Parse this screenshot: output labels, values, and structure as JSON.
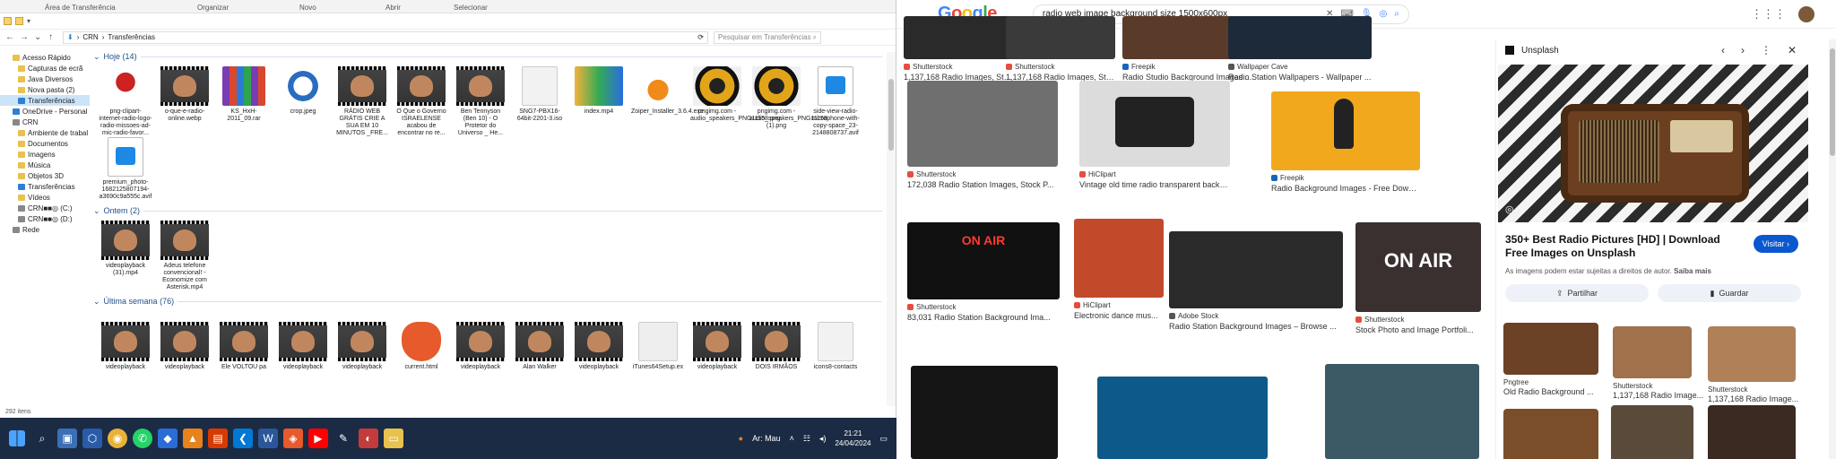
{
  "explorer": {
    "ribbon": {
      "clipboard": "Área de Transferência",
      "organize": "Organizar",
      "new": "Novo",
      "open": "Abrir",
      "select": "Selecionar"
    },
    "breadcrumb": [
      "CRN",
      "Transferências"
    ],
    "search_placeholder": "Pesquisar em Transferências",
    "nav": [
      {
        "label": "Acesso Rápido",
        "type": "star",
        "indent": false
      },
      {
        "label": "Capturas de ecrã",
        "type": "folder",
        "indent": true
      },
      {
        "label": "Java Diversos",
        "type": "folder",
        "indent": true
      },
      {
        "label": "Nova pasta (2)",
        "type": "folder",
        "indent": true
      },
      {
        "label": "Transferências",
        "type": "download",
        "indent": true,
        "selected": true
      },
      {
        "label": "OneDrive - Personal",
        "type": "cloud",
        "indent": false
      },
      {
        "label": "CRN",
        "type": "user",
        "indent": false
      },
      {
        "label": "Ambiente de trabal",
        "type": "folder",
        "indent": true
      },
      {
        "label": "Documentos",
        "type": "folder",
        "indent": true
      },
      {
        "label": "Imagens",
        "type": "folder",
        "indent": true
      },
      {
        "label": "Música",
        "type": "folder",
        "indent": true
      },
      {
        "label": "Objetos 3D",
        "type": "folder",
        "indent": true
      },
      {
        "label": "Transferências",
        "type": "download",
        "indent": true
      },
      {
        "label": "Vídeos",
        "type": "folder",
        "indent": true
      },
      {
        "label": "CRN■■◎ (C:)",
        "type": "drive",
        "indent": true
      },
      {
        "label": "CRN■■◎ (D:)",
        "type": "drive",
        "indent": true
      },
      {
        "label": "Rede",
        "type": "network",
        "indent": false
      }
    ],
    "groups": [
      {
        "label": "Hoje (14)",
        "files": [
          {
            "name": "png-clipart-internet-radio-logo-radio-missoes-ad-mic-radio-favor...",
            "kind": "radio"
          },
          {
            "name": "o-que-e-radio-online.webp",
            "kind": "video"
          },
          {
            "name": "KS_HxH-2011_09.rar",
            "kind": "rar"
          },
          {
            "name": "crop.jpeg",
            "kind": "crop"
          },
          {
            "name": "RÁDIO WEB GRÁTIS CRIE A SUA EM 10 MINUTOS _FRE...",
            "kind": "video"
          },
          {
            "name": "O Que o Governo ISRAELENSE acabou de encontrar no re...",
            "kind": "video"
          },
          {
            "name": "Ben Tennyson (Ben 10) - O Protetor do Universo _ He...",
            "kind": "video"
          },
          {
            "name": "SNG7-PBX16-64bit-2201-3.iso",
            "kind": "doc"
          },
          {
            "name": "index.mp4",
            "kind": "index"
          },
          {
            "name": "Zoiper_Installer_3.6.4.exe",
            "kind": "zoiper"
          },
          {
            "name": "pngimg.com - audio_speakers_PNG11158.png",
            "kind": "speaker"
          },
          {
            "name": "pngimg.com - audio_speakers_PNG11158 (1).png",
            "kind": "speaker"
          },
          {
            "name": "side-view-radio-microphone-with-copy-space_23-2148808737.avif",
            "kind": "avif"
          },
          {
            "name": "premium_photo-1682125807194-a3690c9a555c.avif",
            "kind": "avif"
          }
        ]
      },
      {
        "label": "Ontem (2)",
        "files": [
          {
            "name": "videoplayback (31).mp4",
            "kind": "video"
          },
          {
            "name": "Adeus telefone convencional! - Economize com Asterisk.mp4",
            "kind": "video"
          }
        ]
      },
      {
        "label": "Última semana (76)",
        "files": [
          {
            "name": "videoplayback",
            "kind": "video"
          },
          {
            "name": "videoplayback",
            "kind": "video"
          },
          {
            "name": "Ele VOLTOU pa",
            "kind": "video"
          },
          {
            "name": "videoplayback",
            "kind": "video"
          },
          {
            "name": "videoplayback",
            "kind": "video"
          },
          {
            "name": "current.html",
            "kind": "brave"
          },
          {
            "name": "videoplayback",
            "kind": "video"
          },
          {
            "name": "Alan Walker",
            "kind": "video"
          },
          {
            "name": "videoplayback",
            "kind": "video"
          },
          {
            "name": "iTunes64Setup.ex",
            "kind": "music"
          },
          {
            "name": "videoplayback",
            "kind": "video"
          },
          {
            "name": "DOIS IRMÃOS",
            "kind": "video"
          },
          {
            "name": "icons8-contacts",
            "kind": "doc"
          }
        ]
      }
    ],
    "status": "292 itens"
  },
  "taskbar": {
    "weather": "Ar: Mau",
    "time": "21:21",
    "date": "24/04/2024"
  },
  "google": {
    "logo": [
      "G",
      "o",
      "o",
      "g",
      "l",
      "e"
    ],
    "query": "radio web image background size 1500x600px",
    "results": [
      {
        "source": "Shutterstock",
        "title": "1,137,168 Radio Images, Stock...",
        "color": "#2a2a2a"
      },
      {
        "source": "Shutterstock",
        "title": "1,137,168 Radio Images, Stock...",
        "color": "#3a3a3a"
      },
      {
        "source": "Freepik",
        "title": "Radio Studio Background Images ...",
        "color": "#5a3b2a"
      },
      {
        "source": "Wallpaper Cave",
        "title": "Radio Station Wallpapers - Wallpaper ...",
        "color": "#1d2a3a"
      },
      {
        "source": "Shutterstock",
        "title": "172,038 Radio Station Images, Stock P...",
        "color": "#6f6f6f"
      },
      {
        "source": "HiClipart",
        "title": "Vintage old time radio transparent background P...",
        "color": "#dcdcdc"
      },
      {
        "source": "Freepik",
        "title": "Radio Background Images - Free Download on Freepik",
        "color": "#f2a81d"
      },
      {
        "source": "Shutterstock",
        "title": "83,031 Radio Station Background Ima...",
        "color": "#111111"
      },
      {
        "source": "HiClipart",
        "title": "Electronic dance mus...",
        "color": "#c24a2a"
      },
      {
        "source": "Adobe Stock",
        "title": "Radio Station Background Images – Browse ...",
        "color": "#2a2a2a"
      },
      {
        "source": "Shutterstock",
        "title": "Stock Photo and Image Portfoli...",
        "color": "#3a3030"
      },
      {
        "source": "",
        "title": "",
        "color": "#151515"
      },
      {
        "source": "",
        "title": "",
        "color": "#0d5a8a"
      },
      {
        "source": "",
        "title": "",
        "color": "#3b5a66"
      }
    ],
    "on_air_1": "ON AIR",
    "on_air_2": "ON AIR",
    "panel": {
      "source": "Unsplash",
      "title": "350+ Best Radio Pictures [HD] | Download Free Images on Unsplash",
      "visit": "Visitar",
      "note": "As imagens podem estar sujeitas a direitos de autor.",
      "note_link": "Saiba mais",
      "share": "Partilhar",
      "save": "Guardar",
      "related": [
        {
          "source": "Pngtree",
          "title": "Old Radio Background ..."
        },
        {
          "source": "Shutterstock",
          "title": "1,137,168 Radio Image..."
        },
        {
          "source": "Shutterstock",
          "title": "1,137,168 Radio Image..."
        }
      ]
    }
  }
}
